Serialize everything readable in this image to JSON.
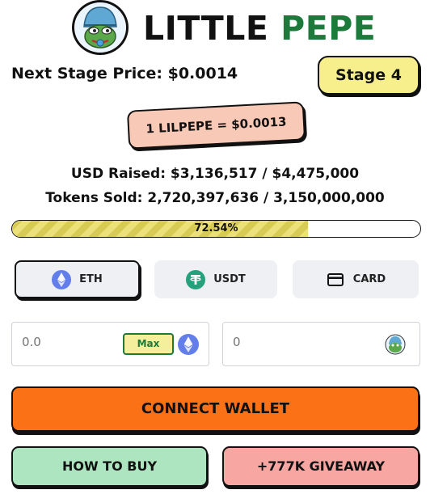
{
  "header": {
    "logo_icon": "pepe-frog-beanie-logo",
    "title_part1": "LITTLE",
    "title_part2": "PEPE"
  },
  "presale": {
    "next_stage_price_text": "Next Stage Price: $0.0014",
    "stage_label": "Stage 4",
    "rate_text": "1 LILPEPE = $0.0013",
    "usd_raised_text": "USD Raised: $3,136,517 / $4,475,000",
    "tokens_sold_text": "Tokens Sold: 2,720,397,636 / 3,150,000,000",
    "progress_label": "72.54%",
    "progress_fraction": 0.7254
  },
  "payment_tabs": [
    {
      "label": "ETH",
      "icon": "ethereum-icon",
      "active": true
    },
    {
      "label": "USDT",
      "icon": "tether-icon",
      "active": false
    },
    {
      "label": "CARD",
      "icon": "credit-card-icon",
      "active": false
    }
  ],
  "inputs": {
    "pay_placeholder": "0.0",
    "max_label": "Max",
    "receive_placeholder": "0"
  },
  "actions": {
    "connect_label": "CONNECT WALLET",
    "howto_label": "HOW TO BUY",
    "giveaway_label": "+777K GIVEAWAY"
  },
  "colors": {
    "brand_green": "#1d7a3b",
    "stage_yellow": "#f7ef8c",
    "rate_peach": "#f9c9b7",
    "connect_orange": "#fb7116",
    "howto_green": "#ace5c0",
    "giveaway_red": "#f7a6a1",
    "eth_blue": "#627eea",
    "usdt_teal": "#26a17b"
  }
}
